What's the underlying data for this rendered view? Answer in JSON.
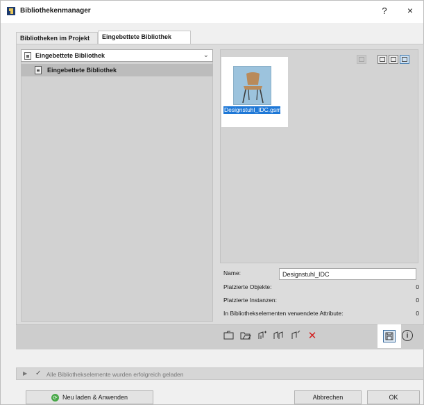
{
  "window": {
    "title": "Bibliothekenmanager",
    "help_glyph": "?",
    "close_glyph": "×"
  },
  "tabs": [
    {
      "label": "Bibliotheken im Projekt"
    },
    {
      "label": "Eingebettete Bibliothek"
    }
  ],
  "library_selector": {
    "selected": "Eingebettete Bibliothek",
    "chevron": "⌄"
  },
  "tree": {
    "items": [
      {
        "label": "Eingebettete Bibliothek"
      }
    ]
  },
  "preview": {
    "item_label": "Designstuhl_IDC.gsm"
  },
  "properties": {
    "name_label": "Name:",
    "name_value": "Designstuhl_IDC",
    "rows": [
      {
        "label": "Platzierte Objekte:",
        "value": "0"
      },
      {
        "label": "Platzierte Instanzen:",
        "value": "0"
      },
      {
        "label": "In Bibliothekselementen verwendete Attribute:",
        "value": "0"
      }
    ]
  },
  "toolbar": {
    "delete_glyph": "✕",
    "info_glyph": "i"
  },
  "status": {
    "check_glyph": "✓",
    "message": "Alle Bibliothekselemente wurden erfolgreich geladen"
  },
  "footer": {
    "reload_label": "Neu laden & Anwenden",
    "cancel_label": "Abbrechen",
    "ok_label": "OK"
  },
  "colors": {
    "selection": "#1e78d7",
    "delete": "#d32020",
    "reload_icon": "#48a848"
  }
}
